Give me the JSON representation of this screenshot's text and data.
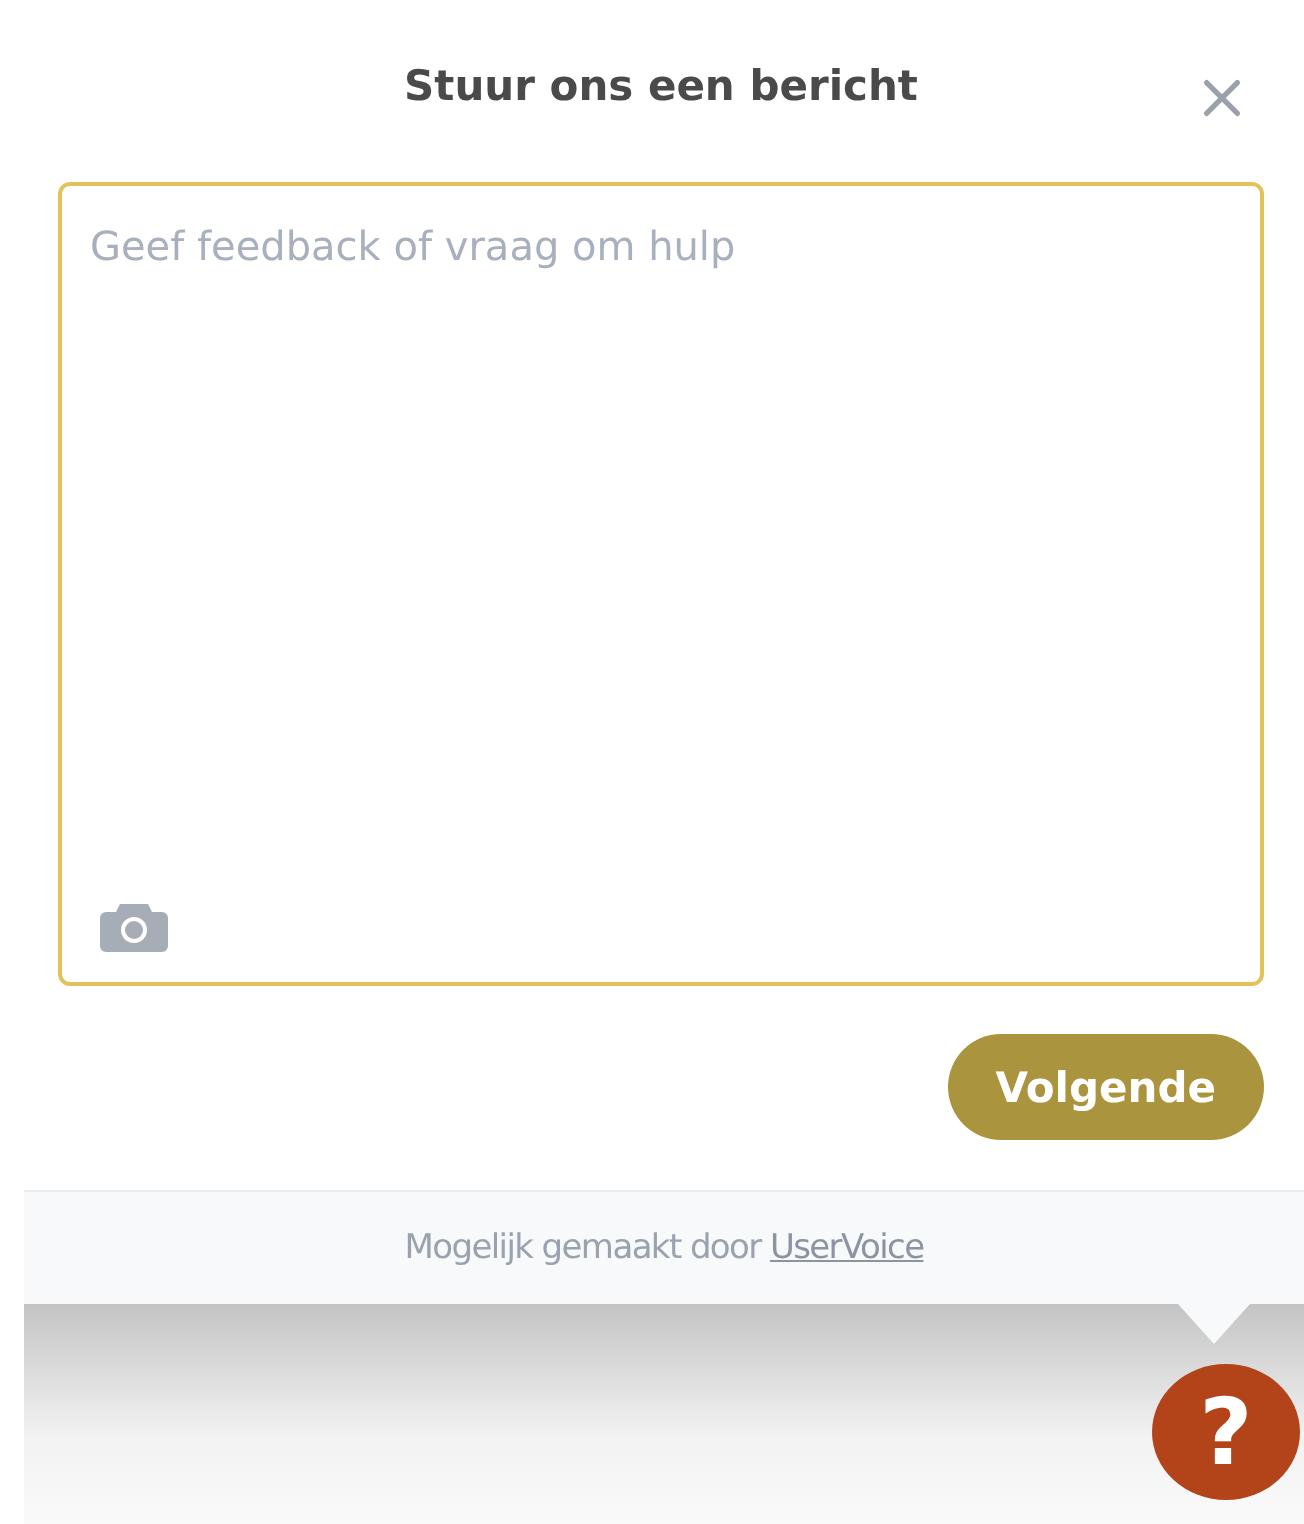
{
  "dialog": {
    "title": "Stuur ons een bericht"
  },
  "message": {
    "placeholder": "Geef feedback of vraag om hulp"
  },
  "next_button": {
    "label": "Volgende"
  },
  "footer": {
    "text": "Mogelijk gemaakt door ",
    "link": "UserVoice"
  },
  "help_button": {
    "label": "?"
  }
}
